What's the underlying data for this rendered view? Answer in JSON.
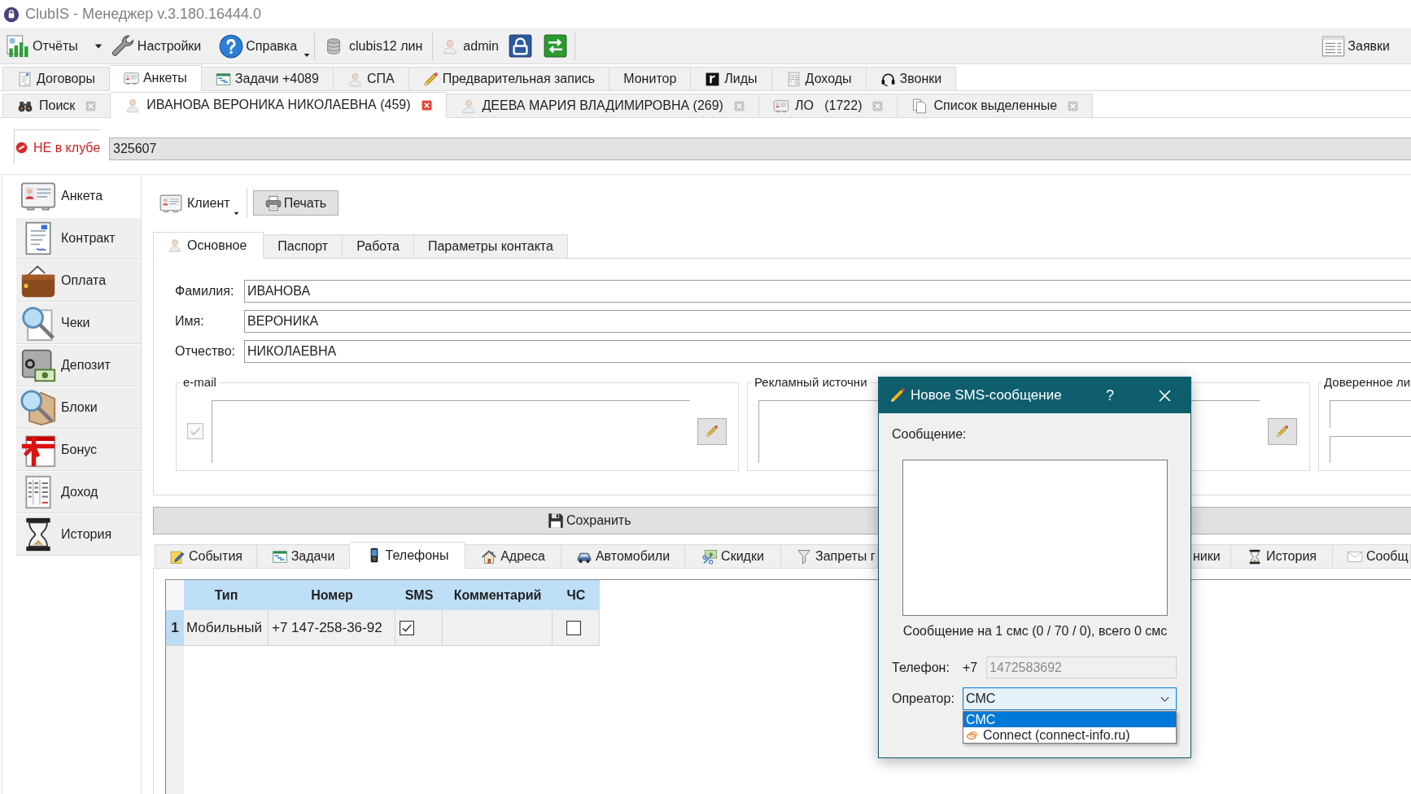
{
  "window": {
    "title": "ClubIS - Менеджер v.3.180.16444.0"
  },
  "toolbar": {
    "menus": [
      {
        "label": "Отчёты",
        "kind": "split-menu"
      },
      {
        "label": "Настройки",
        "kind": "button"
      },
      {
        "label": "Справка",
        "kind": "menu"
      }
    ],
    "connection": "clubis12 лин",
    "user": "admin",
    "requests": "Заявки"
  },
  "main_tabs": [
    {
      "label": "Договоры",
      "selected": false
    },
    {
      "label": "Анкеты",
      "selected": true
    },
    {
      "label": "Задачи +4089",
      "selected": false
    },
    {
      "label": "СПА",
      "selected": false
    },
    {
      "label": "Предварительная запись",
      "selected": false
    },
    {
      "label": "Монитор",
      "selected": false
    },
    {
      "label": "Лиды",
      "selected": false
    },
    {
      "label": "Доходы",
      "selected": false
    },
    {
      "label": "Звонки",
      "selected": false
    }
  ],
  "document_tabs": [
    {
      "label": "Поиск",
      "selected": false
    },
    {
      "label": "ИВАНОВА ВЕРОНИКА НИКОЛАЕВНА (459)",
      "selected": true
    },
    {
      "label": "ДЕЕВА МАРИЯ ВЛАДИМИРОВНА (269)",
      "selected": false
    },
    {
      "label": "ЛО   (1722)",
      "selected": false
    },
    {
      "label": "Список выделенные",
      "selected": false
    }
  ],
  "client_status": {
    "label": "НЕ в клубе",
    "card_number": "325607"
  },
  "sidebar": {
    "items": [
      {
        "label": "Анкета",
        "selected": true
      },
      {
        "label": "Контракт",
        "selected": false
      },
      {
        "label": "Оплата",
        "selected": false
      },
      {
        "label": "Чеки",
        "selected": false
      },
      {
        "label": "Депозит",
        "selected": false
      },
      {
        "label": "Блоки",
        "selected": false
      },
      {
        "label": "Бонус",
        "selected": false
      },
      {
        "label": "Доход",
        "selected": false
      },
      {
        "label": "История",
        "selected": false
      }
    ]
  },
  "client_toolbar": {
    "client_menu": {
      "label": "Клиент",
      "dropdown": true
    },
    "print_button": "Печать"
  },
  "form_tabs": [
    {
      "label": "Основное",
      "selected": true
    },
    {
      "label": "Паспорт",
      "selected": false
    },
    {
      "label": "Работа",
      "selected": false
    },
    {
      "label": "Параметры контакта",
      "selected": false
    }
  ],
  "fields": [
    {
      "label": "Фамилия:",
      "value": "ИВАНОВА"
    },
    {
      "label": "Имя:",
      "value": "ВЕРОНИКА"
    },
    {
      "label": "Отчество:",
      "value": "НИКОЛАЕВНА"
    }
  ],
  "email_group": {
    "title": "e-mail",
    "checked": true,
    "disabled": true
  },
  "source_group": {
    "title": "Рекламный источни"
  },
  "trusted_person_group": {
    "title": "Доверенное ли"
  },
  "save_button": "Сохранить",
  "detail_tabs": [
    {
      "label": "События",
      "selected": false
    },
    {
      "label": "Задачи",
      "selected": false
    },
    {
      "label": "Телефоны",
      "selected": true
    },
    {
      "label": "Адреса",
      "selected": false
    },
    {
      "label": "Автомобили",
      "selected": false
    },
    {
      "label": "Скидки",
      "selected": false
    },
    {
      "label": "Запреты г",
      "selected": false
    },
    {
      "label": "ники",
      "selected": false
    },
    {
      "label": "История",
      "selected": false
    },
    {
      "label": "Сообщ",
      "selected": false
    }
  ],
  "phones_table": {
    "columns": [
      "Тип",
      "Номер",
      "SMS",
      "Комментарий",
      "ЧС"
    ],
    "rows": [
      {
        "number": "1",
        "type": "Мобильный",
        "phone": "+7 147-258-36-92",
        "sms": true,
        "chs": false
      }
    ]
  },
  "sms_dialog": {
    "title": "Новое SMS-сообщение",
    "help": "?",
    "message_label": "Сообщение:",
    "counter": "Сообщение на 1 смс (0 / 70 / 0), всего 0 смс",
    "phone": {
      "label": "Телефон:",
      "prefix": "+7",
      "value": "1472583692",
      "disabled": true
    },
    "operator": {
      "label": "Опреатор:",
      "value": "СМС",
      "open": true,
      "options": [
        {
          "label": "СМС",
          "selected": true
        },
        {
          "label": "Connect (connect-info.ru)",
          "selected": false
        }
      ]
    }
  }
}
